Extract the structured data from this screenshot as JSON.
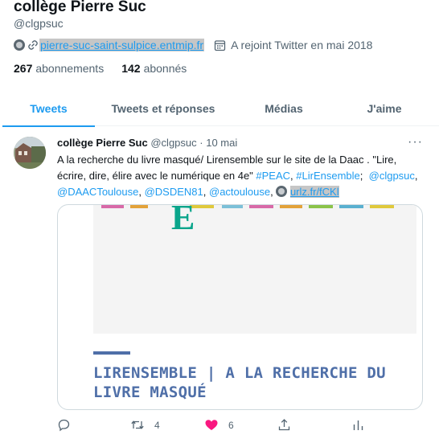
{
  "profile": {
    "name": "collège Pierre Suc",
    "handle": "@clgpsuc",
    "website": "pierre-suc-saint-sulpice.entmip.fr",
    "joined": "A rejoint Twitter en mai 2018",
    "following_count": "267",
    "following_label": "abonnements",
    "followers_count": "142",
    "followers_label": "abonnés"
  },
  "tabs": [
    {
      "label": "Tweets",
      "active": true
    },
    {
      "label": "Tweets et réponses",
      "active": false
    },
    {
      "label": "Médias",
      "active": false
    },
    {
      "label": "J'aime",
      "active": false
    }
  ],
  "tweet": {
    "author_name": "collège Pierre Suc",
    "author_handle": "@clgpsuc",
    "separator": "·",
    "date": "10 mai",
    "more": "···",
    "text_part1": "A la recherche du livre masqué/ Lirensemble sur le site de la Daac . \"Lire, écrire, dire, élire avec le numérique en 4e\" ",
    "hashtag_peac": "#PEAC",
    "comma": ", ",
    "hashtag_lir": "#LirEnsemble",
    "mention_clg": "@clgpsuc",
    "mention_daac": "@DAACToulouse",
    "mention_dsden": "@DSDEN81",
    "mention_actou": "@actoulouse",
    "short_url": "urlz.fr/fCKl",
    "card_letter": "E",
    "card_title": "LIRENSEMBLE | A LA RECHERCHE DU LIVRE MASQUÉ",
    "retweets": "4",
    "likes": "6"
  },
  "colors": {
    "accent": "#1d9bf0",
    "text": "#0f1419",
    "muted": "#536471",
    "like": "#f91880",
    "card_title": "#4f6fa8",
    "card_e": "#0aa58b"
  },
  "icons": [
    "verified-badge-icon",
    "link-icon",
    "calendar-icon",
    "reply-icon",
    "retweet-icon",
    "heart-icon",
    "share-icon",
    "analytics-icon",
    "more-icon"
  ]
}
